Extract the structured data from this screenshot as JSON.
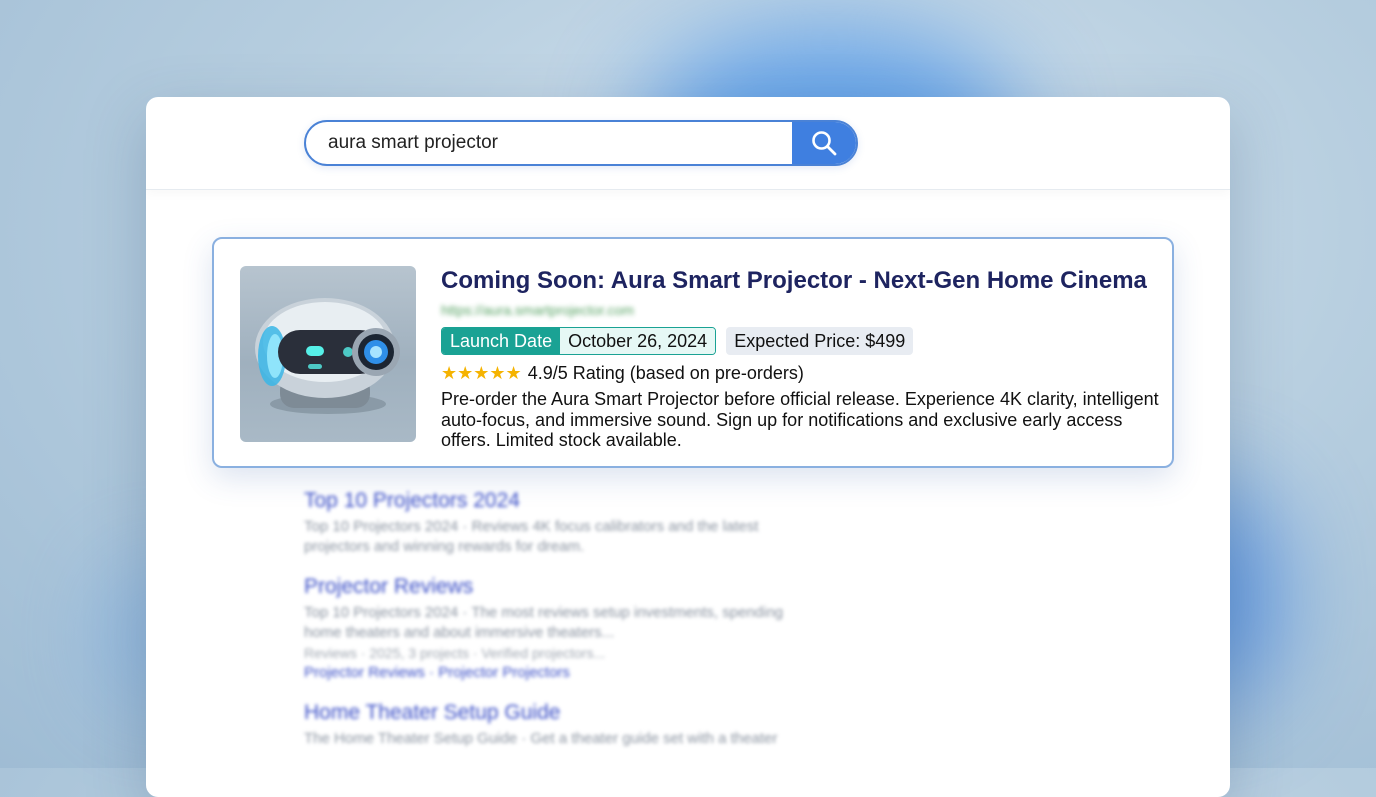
{
  "search": {
    "query": "aura smart projector"
  },
  "featured": {
    "title": "Coming Soon: Aura Smart Projector - Next-Gen Home Cinema",
    "url": "https://aura.smartprojector.com",
    "launch_label": "Launch Date",
    "launch_date": "October 26, 2024",
    "price": "Expected Price: $499",
    "stars": "★★★★★",
    "rating": "4.9/5 Rating (based on pre-orders)",
    "description": "Pre-order the Aura Smart Projector before official release. Experience 4K clarity, intelligent auto-focus, and immersive sound. Sign up for notifications and exclusive early access offers. Limited stock available."
  },
  "results": [
    {
      "title": "Top 10 Projectors 2024",
      "snippet": "Top 10 Projectors 2024 · Reviews 4K focus calibrators and the latest projectors and winning rewards for dream."
    },
    {
      "title": "Projector Reviews",
      "snippet": "Top 10 Projectors 2024 · The most reviews setup investments, spending home theaters and about immersive theaters...",
      "meta": "Reviews · 2025, 3 projects · Verified projectors...",
      "links": "Projector Reviews · Projector Projectors"
    },
    {
      "title": "Home Theater Setup Guide",
      "snippet": "The Home Theater Setup Guide · Get a theater guide set with a theater"
    }
  ]
}
